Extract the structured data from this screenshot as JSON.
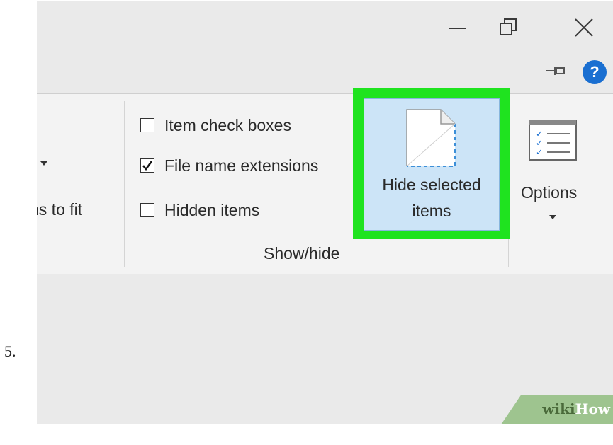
{
  "step": {
    "number": "5."
  },
  "window": {
    "minimize_icon": "minimize-icon",
    "restore_icon": "restore-icon",
    "close_icon": "close-icon"
  },
  "ribbon": {
    "pin_icon": "pin-icon",
    "help_label": "?",
    "layout_partial_label": "ns to fit",
    "show_hide": {
      "group_label": "Show/hide",
      "checkboxes": [
        {
          "label": "Item check boxes",
          "checked": false
        },
        {
          "label": "File name extensions",
          "checked": true
        },
        {
          "label": "Hidden items",
          "checked": false
        }
      ],
      "hide_selected": {
        "line1": "Hide selected",
        "line2": "items"
      }
    },
    "options": {
      "label": "Options"
    }
  },
  "highlight_color": "#1fe31f",
  "watermark": {
    "wiki": "wiki",
    "how": "How"
  }
}
